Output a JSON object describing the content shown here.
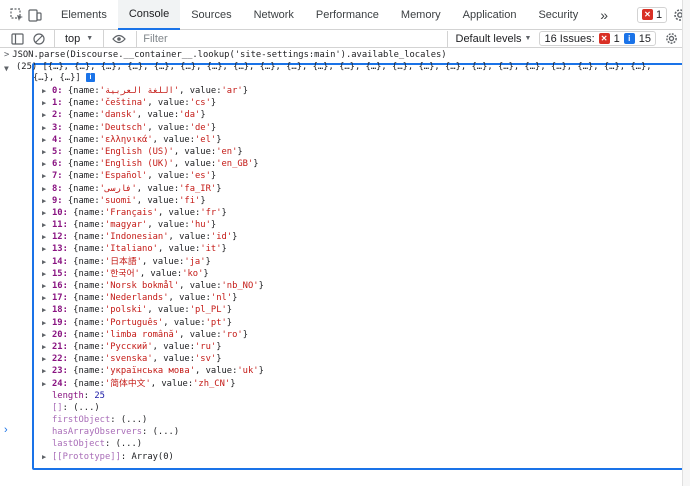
{
  "toolbar": {
    "tabs": [
      "Elements",
      "Console",
      "Sources",
      "Network",
      "Performance",
      "Memory",
      "Application",
      "Security"
    ],
    "more": "»",
    "error_count": "1"
  },
  "filterbar": {
    "context": "top",
    "filter_placeholder": "Filter",
    "levels": "Default levels",
    "issues_label": "16 Issues:",
    "issues_errors": "1",
    "issues_info": "15"
  },
  "console": {
    "command": "JSON.parse(Discourse.__container__.lookup('site-settings:main').available_locales)",
    "summary_line1": "(25) [{…}, {…}, {…}, {…}, {…}, {…}, {…}, {…}, {…}, {…}, {…}, {…}, {…}, {…}, {…}, {…}, {…}, {…}, {…}, {…}, {…}, {…}, {…},",
    "summary_line2": "{…}, {…}]",
    "info_badge": "i",
    "items": [
      {
        "idx": "0:",
        "name": "'اللغة العربية'",
        "value": "'ar'"
      },
      {
        "idx": "1:",
        "name": "'čeština'",
        "value": "'cs'"
      },
      {
        "idx": "2:",
        "name": "'dansk'",
        "value": "'da'"
      },
      {
        "idx": "3:",
        "name": "'Deutsch'",
        "value": "'de'"
      },
      {
        "idx": "4:",
        "name": "'ελληνικά'",
        "value": "'el'"
      },
      {
        "idx": "5:",
        "name": "'English (US)'",
        "value": "'en'"
      },
      {
        "idx": "6:",
        "name": "'English (UK)'",
        "value": "'en_GB'"
      },
      {
        "idx": "7:",
        "name": "'Español'",
        "value": "'es'"
      },
      {
        "idx": "8:",
        "name": "'فارسی'",
        "value": "'fa_IR'"
      },
      {
        "idx": "9:",
        "name": "'suomi'",
        "value": "'fi'"
      },
      {
        "idx": "10:",
        "name": "'Français'",
        "value": "'fr'"
      },
      {
        "idx": "11:",
        "name": "'magyar'",
        "value": "'hu'"
      },
      {
        "idx": "12:",
        "name": "'Indonesian'",
        "value": "'id'"
      },
      {
        "idx": "13:",
        "name": "'Italiano'",
        "value": "'it'"
      },
      {
        "idx": "14:",
        "name": "'日本語'",
        "value": "'ja'"
      },
      {
        "idx": "15:",
        "name": "'한국어'",
        "value": "'ko'"
      },
      {
        "idx": "16:",
        "name": "'Norsk bokmål'",
        "value": "'nb_NO'"
      },
      {
        "idx": "17:",
        "name": "'Nederlands'",
        "value": "'nl'"
      },
      {
        "idx": "18:",
        "name": "'polski'",
        "value": "'pl_PL'"
      },
      {
        "idx": "19:",
        "name": "'Português'",
        "value": "'pt'"
      },
      {
        "idx": "20:",
        "name": "'limba română'",
        "value": "'ro'"
      },
      {
        "idx": "21:",
        "name": "'Русский'",
        "value": "'ru'"
      },
      {
        "idx": "22:",
        "name": "'svenska'",
        "value": "'sv'"
      },
      {
        "idx": "23:",
        "name": "'українська мова'",
        "value": "'uk'"
      },
      {
        "idx": "24:",
        "name": "'简体中文'",
        "value": "'zh_CN'"
      }
    ],
    "length_key": "length",
    "length_value": "25",
    "props": [
      {
        "key": "[]",
        "value": "(...)"
      },
      {
        "key": "firstObject",
        "value": "(...)"
      },
      {
        "key": "hasArrayObservers",
        "value": "(...)"
      },
      {
        "key": "lastObject",
        "value": "(...)"
      }
    ],
    "prototype_key": "[[Prototype]]",
    "prototype_value": "Array(0)"
  }
}
